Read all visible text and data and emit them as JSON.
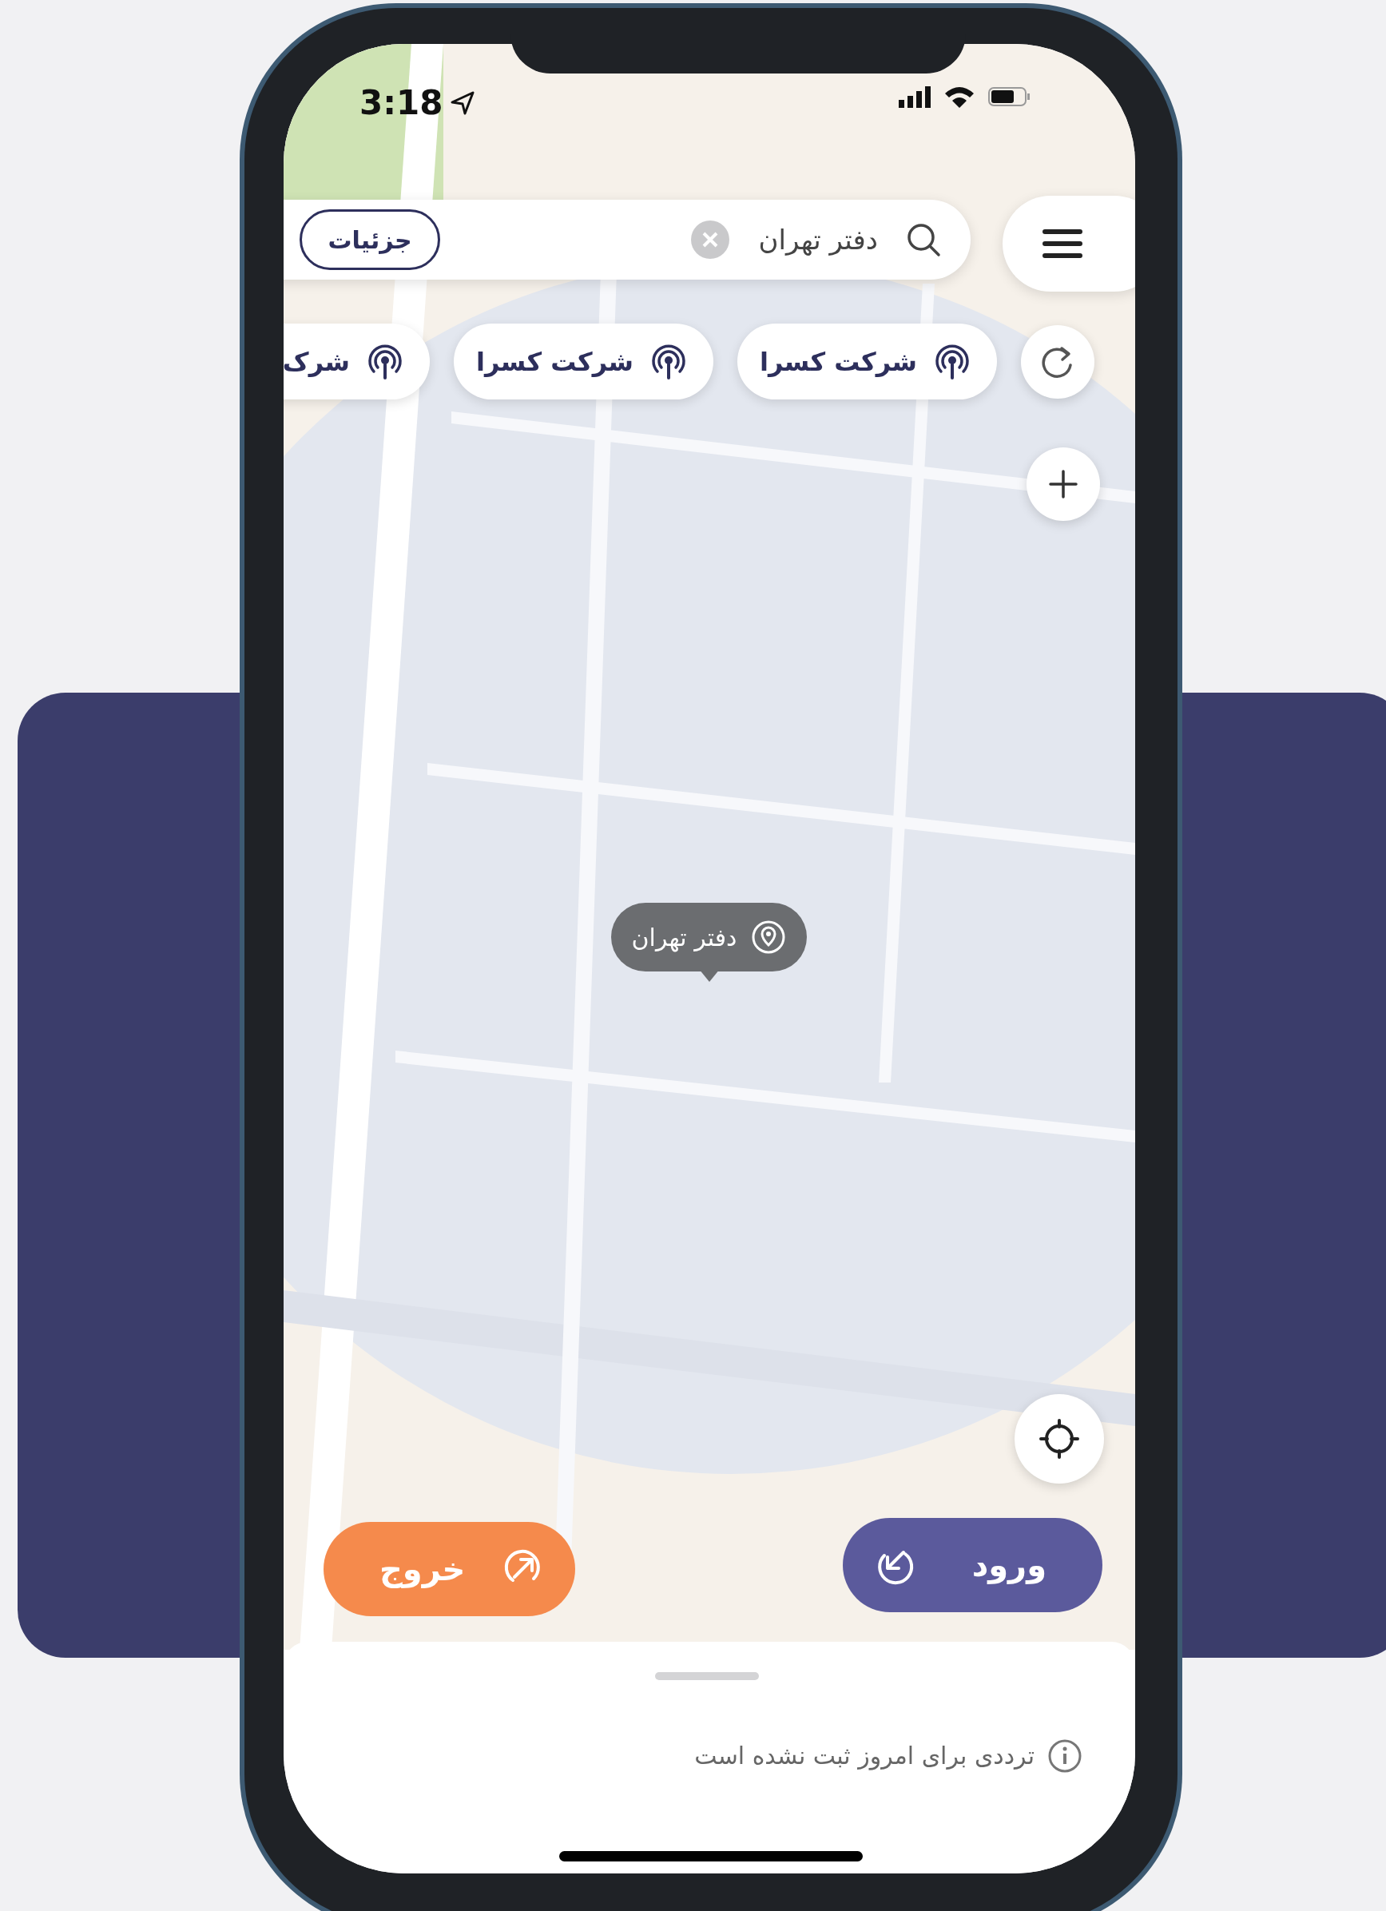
{
  "status_bar": {
    "time": "3:18"
  },
  "search": {
    "value": "دفتر تهران",
    "details_button": "جزئیات"
  },
  "chips": [
    {
      "label": "شرکت کسرا"
    },
    {
      "label": "شرکت کسرا"
    },
    {
      "label": "شرک"
    }
  ],
  "map_marker": {
    "label": "دفتر تهران"
  },
  "actions": [
    {
      "kind": "entry",
      "label": "ورود"
    },
    {
      "kind": "exit",
      "label": "خروج"
    }
  ],
  "sheet": {
    "message": "ترددی برای امروز ثبت نشده است"
  }
}
